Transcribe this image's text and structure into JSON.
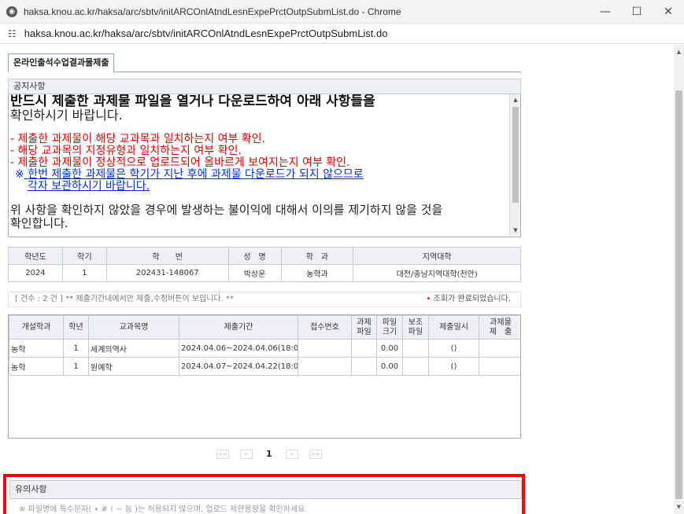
{
  "window": {
    "title": "haksa.knou.ac.kr/haksa/arc/sbtv/initARCOnlAtndLesnExpePrctOutpSubmList.do - Chrome",
    "url": "haksa.knou.ac.kr/haksa/arc/sbtv/initARCOnlAtndLesnExpePrctOutpSubmList.do",
    "minimize": "—",
    "maximize": "☐",
    "close": "✕"
  },
  "tab": {
    "label": "온라인출석수업결과물제출"
  },
  "notice": {
    "header": "공지사항",
    "line1": "반드시 제출한 과제물 파일을 열거나 다운로드하여 아래 사항들을",
    "line2": "확인하시기 바랍니다.",
    "red1": "- 제출한 과제물이 해당 교과목과 일치하는지 여부 확인.",
    "red2": "- 해당 교과목의 지정유형과 일치하는지 여부 확인.",
    "red3": "- 제출한 과제물이 정상적으로 업로드되어 올바르게 보여지는지 여부 확인.",
    "blue_mark": "※",
    "blue1": "한번 제출한 과제물은 학기가 지난 후에 과제물 다운로드가 되지 않으므로",
    "blue2": "각자 보관하시기 바랍니다.",
    "plain1": "위 사항을 확인하지 않았을 경우에 발생하는 불이익에 대해서 이의를 제기하지 않을 것을",
    "plain2": "확인합니다."
  },
  "student": {
    "headers": [
      "학년도",
      "학기",
      "학　　번",
      "성　명",
      "학　과",
      "지역대학"
    ],
    "values": [
      "2024",
      "1",
      "202431-148067",
      "박상운",
      "농학과",
      "대전/충남지역대학(천안)"
    ]
  },
  "countbar": {
    "left": "[ 건수 : 2 건 ] ** 제출기간내에서만 제출,수정버튼이 보입니다. **",
    "right": "조회가 완료되었습니다."
  },
  "grid": {
    "headers": [
      "개설학과",
      "학년",
      "교과목명",
      "제출기간",
      "접수번호",
      "과제\n파일",
      "파일\n크기",
      "보조\n파일",
      "제출일시",
      "과제물\n제　출"
    ],
    "rows": [
      [
        "농학",
        "1",
        "세계의역사",
        "2024.04.06~2024.04.06(18:0",
        "",
        "",
        "0.00",
        "",
        "()",
        ""
      ],
      [
        "농학",
        "1",
        "원예학",
        "2024.04.07~2024.04.22(18:0",
        "",
        "",
        "0.00",
        "",
        "()",
        ""
      ]
    ]
  },
  "pager": {
    "first": "<<",
    "prev": "<",
    "current": "1",
    "next": ">",
    "last": ">>"
  },
  "caution": {
    "header": "유의사항",
    "text": "※ 파일명에 특수문자( • # ! ~ 등 )는 허용되지 않으며, 업로드 제한용량을 확인하세요."
  }
}
